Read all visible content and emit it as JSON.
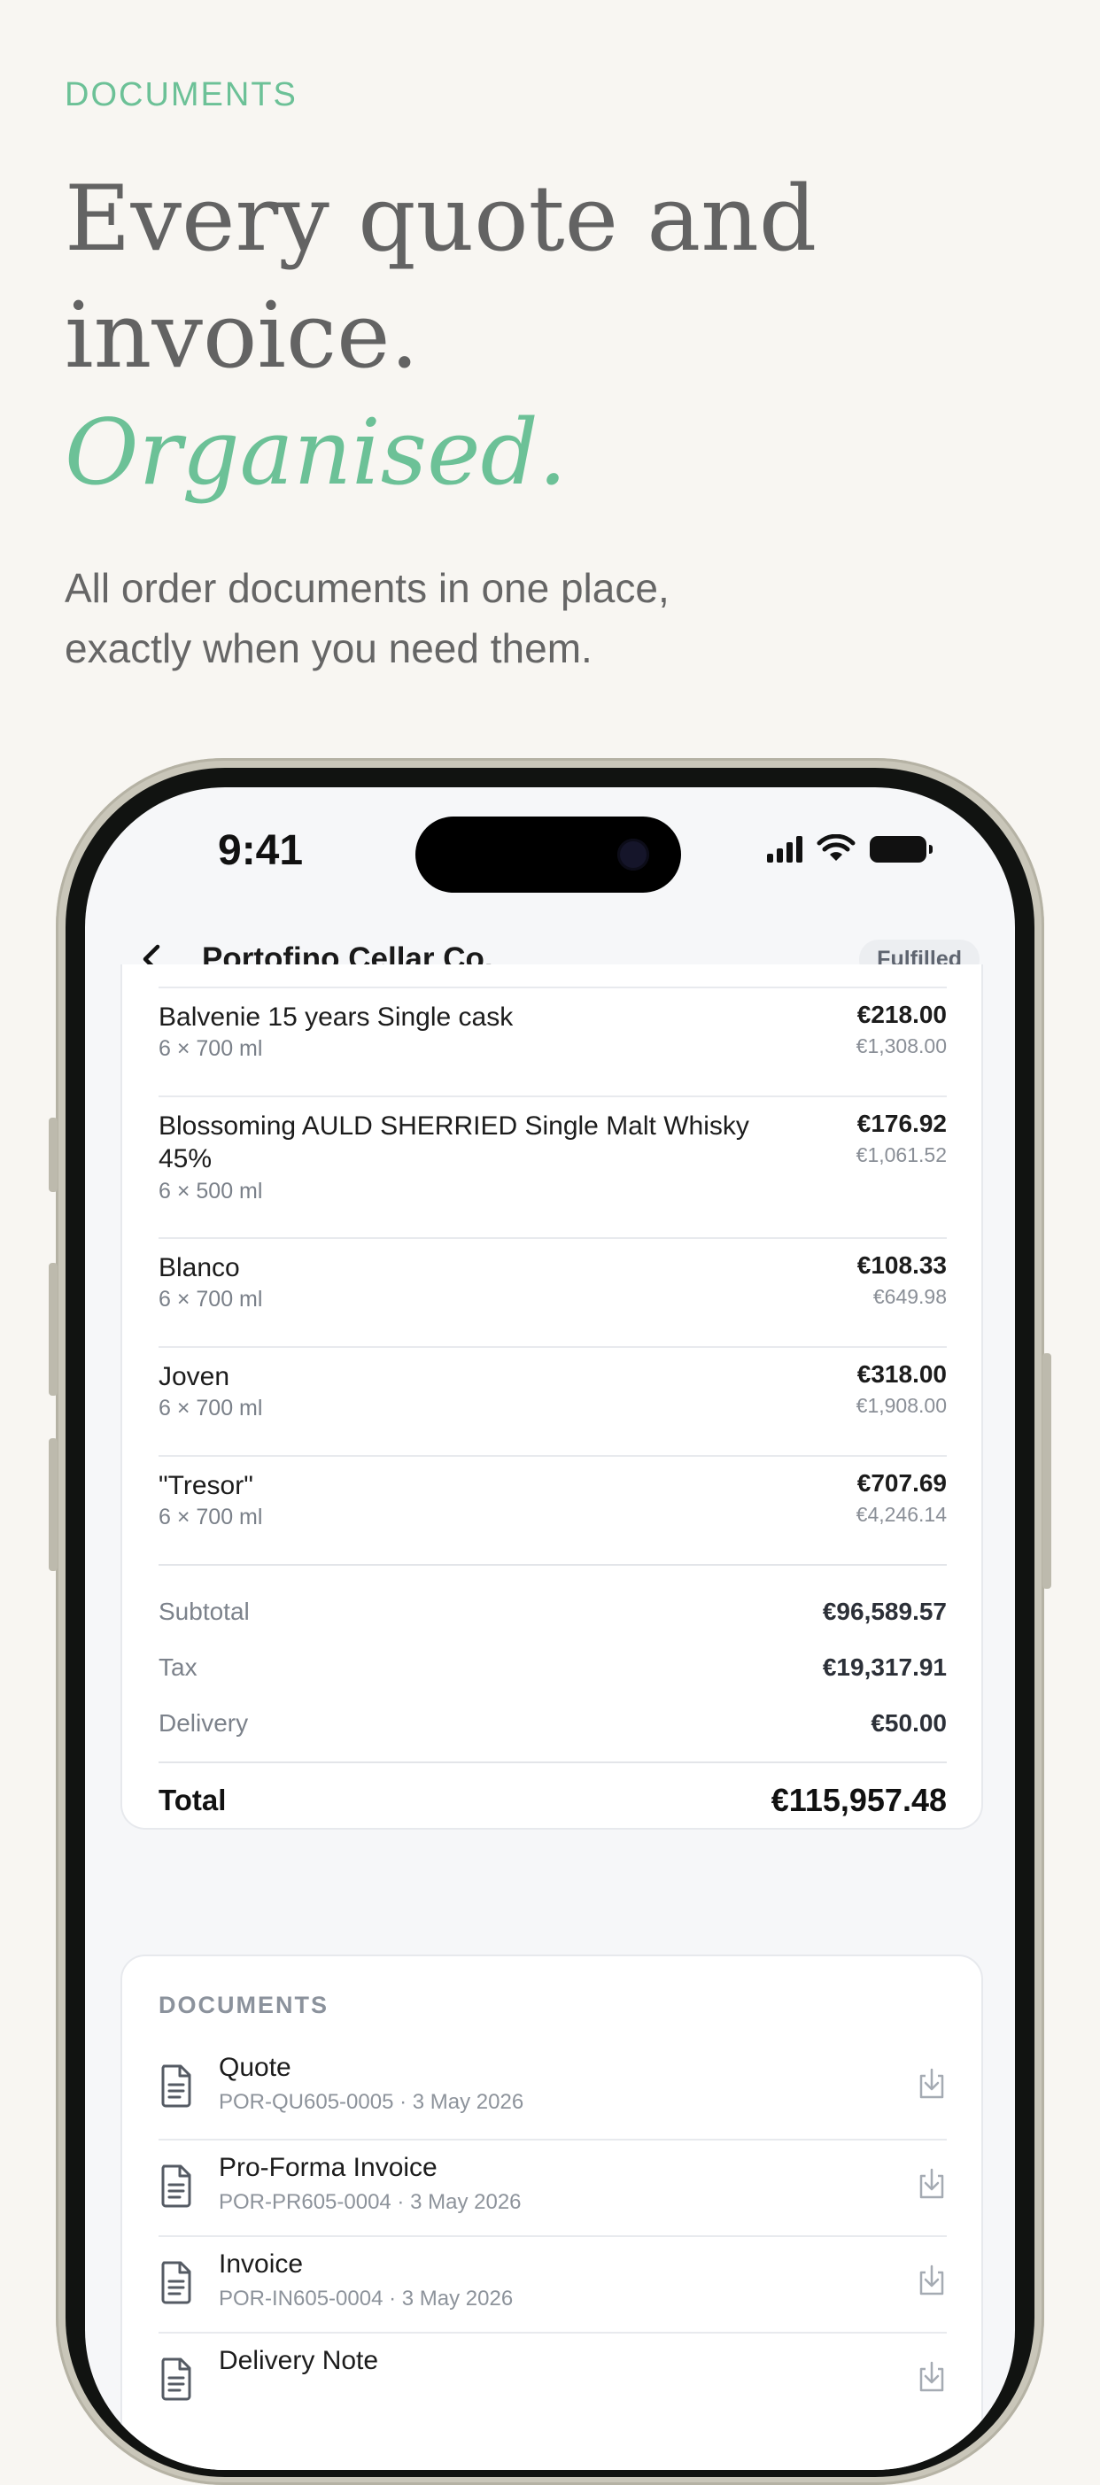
{
  "hero": {
    "eyebrow": "DOCUMENTS",
    "headline_line1": "Every quote and",
    "headline_line2": "invoice.",
    "headline_accent": "Organised.",
    "subtitle_line1": "All order documents in one place,",
    "subtitle_line2": "exactly when you need them."
  },
  "status_bar": {
    "time": "9:41"
  },
  "nav": {
    "title": "Portofino Cellar Co.",
    "status_badge": "Fulfilled"
  },
  "line_items": [
    {
      "name": "Balvenie 15 years Single cask",
      "qty": "6 × 700 ml",
      "price": "€218.00",
      "line_total": "€1,308.00"
    },
    {
      "name": "Blossoming AULD SHERRIED Single Malt Whisky 45%",
      "qty": "6 × 500 ml",
      "price": "€176.92",
      "line_total": "€1,061.52"
    },
    {
      "name": "Blanco",
      "qty": "6 × 700 ml",
      "price": "€108.33",
      "line_total": "€649.98"
    },
    {
      "name": "Joven",
      "qty": "6 × 700 ml",
      "price": "€318.00",
      "line_total": "€1,908.00"
    },
    {
      "name": "\"Tresor\"",
      "qty": "6 × 700 ml",
      "price": "€707.69",
      "line_total": "€4,246.14"
    }
  ],
  "summary": {
    "subtotal_label": "Subtotal",
    "subtotal": "€96,589.57",
    "tax_label": "Tax",
    "tax": "€19,317.91",
    "delivery_label": "Delivery",
    "delivery": "€50.00",
    "total_label": "Total",
    "total": "€115,957.48"
  },
  "documents": {
    "header": "DOCUMENTS",
    "items": [
      {
        "title": "Quote",
        "meta": "POR-QU605-0005 · 3 May 2026",
        "icon": "document-icon"
      },
      {
        "title": "Pro-Forma Invoice",
        "meta": "POR-PR605-0004 · 3 May 2026",
        "icon": "document-icon"
      },
      {
        "title": "Invoice",
        "meta": "POR-IN605-0004 · 3 May 2026",
        "icon": "document-icon"
      },
      {
        "title": "Delivery Note",
        "meta": "",
        "icon": "document-icon"
      }
    ]
  },
  "colors": {
    "accent": "#6cc197",
    "background": "#f8f6f2",
    "headline": "#636363"
  }
}
